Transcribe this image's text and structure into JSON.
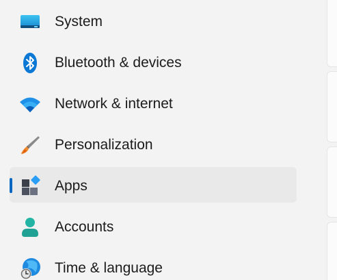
{
  "sidebar": {
    "items": [
      {
        "label": "System",
        "icon": "monitor-icon"
      },
      {
        "label": "Bluetooth & devices",
        "icon": "bluetooth-icon"
      },
      {
        "label": "Network & internet",
        "icon": "wifi-icon"
      },
      {
        "label": "Personalization",
        "icon": "paintbrush-icon"
      },
      {
        "label": "Apps",
        "icon": "apps-icon",
        "selected": true
      },
      {
        "label": "Accounts",
        "icon": "person-icon"
      },
      {
        "label": "Time & language",
        "icon": "globe-clock-icon"
      }
    ]
  },
  "colors": {
    "accent": "#0067c0",
    "selected_bg": "#e9e9e9",
    "window_bg": "#f3f3f3"
  }
}
